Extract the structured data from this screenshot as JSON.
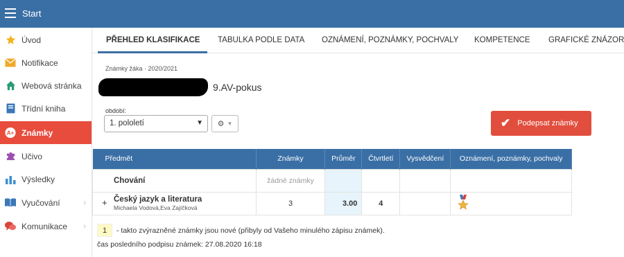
{
  "app": {
    "title": "Start"
  },
  "sidebar": {
    "items": [
      {
        "label": "Úvod",
        "icon": "star-icon"
      },
      {
        "label": "Notifikace",
        "icon": "envelope-icon"
      },
      {
        "label": "Webová stránka",
        "icon": "home-icon"
      },
      {
        "label": "Třídní kniha",
        "icon": "book-icon"
      },
      {
        "label": "Známky",
        "icon": "grades-icon",
        "active": true
      },
      {
        "label": "Učivo",
        "icon": "puzzle-icon"
      },
      {
        "label": "Výsledky",
        "icon": "bar-chart-icon"
      },
      {
        "label": "Vyučování",
        "icon": "open-book-icon",
        "chevron": "›"
      },
      {
        "label": "Komunikace",
        "icon": "chat-icon",
        "chevron": "›"
      }
    ]
  },
  "tabs": [
    {
      "label": "PŘEHLED KLASIFIKACE",
      "active": true
    },
    {
      "label": "TABULKA PODLE DATA"
    },
    {
      "label": "OZNÁMENÍ, POZNÁMKY, POCHVALY"
    },
    {
      "label": "KOMPETENCE"
    },
    {
      "label": "GRAFICKÉ ZNÁZORN"
    }
  ],
  "student": {
    "header": "Známky žáka · 2020/2021",
    "class_name": "9.AV-pokus"
  },
  "period": {
    "label": "období:",
    "selected": "1. pololetí"
  },
  "sign_button": {
    "label": "Podepsat známky"
  },
  "table": {
    "headers": {
      "subject": "Předmět",
      "grades": "Známky",
      "average": "Průměr",
      "quarter": "Čtvrtletí",
      "report": "Vysvědčení",
      "notes": "Oznámení, poznámky, pochvaly"
    },
    "rows": [
      {
        "subject": "Chování",
        "teachers": "",
        "grades": "žádné známky",
        "average": "",
        "quarter": "",
        "report": "",
        "notes": ""
      },
      {
        "subject": "Český jazyk a literatura",
        "teachers": "Michaela Vodová,Eva Zajíčková",
        "grades": "3",
        "average": "3.00",
        "quarter": "4",
        "report": "",
        "notes": "medal-icon",
        "expand": "+"
      }
    ]
  },
  "legend": {
    "sample": "1",
    "text": "- takto zvýrazněné známky jsou nové (přibyly od Vašeho minulého zápisu známek).",
    "last_sign": "čas posledního podpisu známek: 27.08.2020 16:18"
  },
  "colors": {
    "topbar": "#3a6fa5",
    "active": "#e84c3d",
    "sign_button": "#e14e3d",
    "highlight_new": "#fff9c4"
  }
}
